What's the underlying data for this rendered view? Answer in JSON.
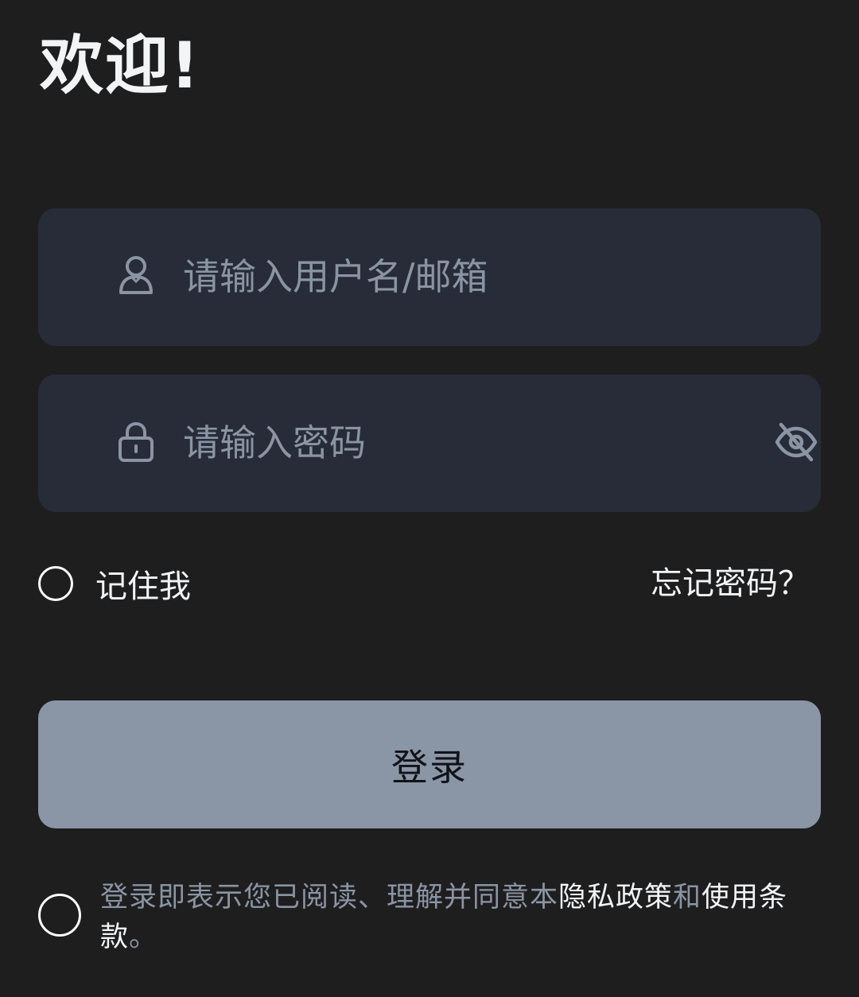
{
  "header": {
    "title": "欢迎!"
  },
  "form": {
    "username": {
      "placeholder": "请输入用户名/邮箱",
      "value": "",
      "icon": "user-icon"
    },
    "password": {
      "placeholder": "请输入密码",
      "value": "",
      "icon": "lock-icon",
      "toggle_icon": "eye-off-icon"
    },
    "remember_label": "记住我",
    "forgot_label": "忘记密码？",
    "login_label": "登录"
  },
  "agreement": {
    "prefix": "登录即表示您已阅读、理解并同意本",
    "privacy_link": "隐私政策",
    "conjunction": "和",
    "terms_link": "使用条款",
    "suffix": "。"
  },
  "colors": {
    "background": "#1e1e1f",
    "field_background": "#272c38",
    "placeholder": "#8a94a3",
    "button_background": "#8a96a6",
    "text_primary": "#f3f4f6"
  }
}
